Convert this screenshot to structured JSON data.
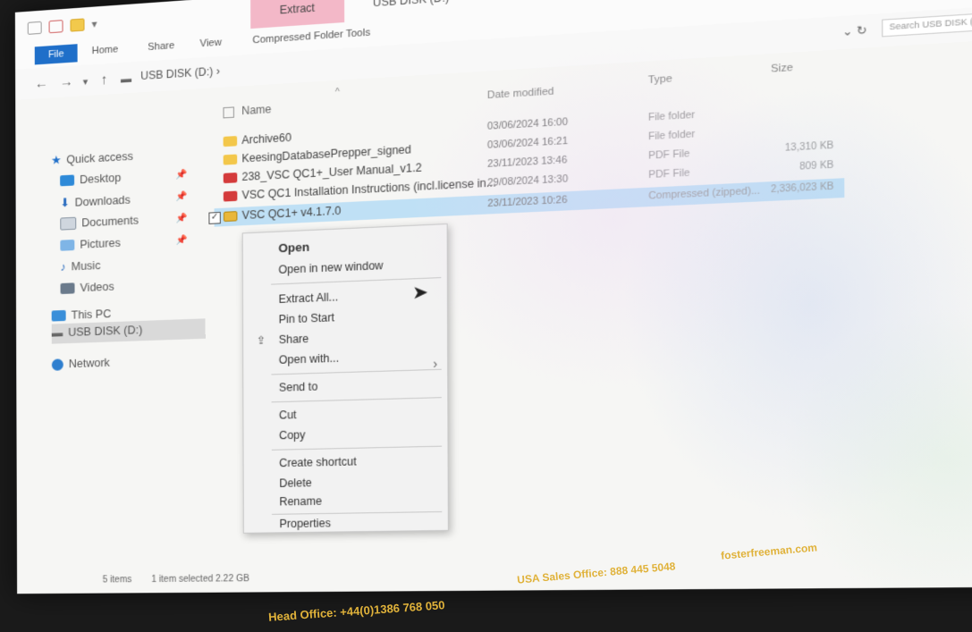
{
  "titlebar": {
    "context_tab": "Extract",
    "window_title": "USB DISK (D:)",
    "controls": [
      "—",
      "☐",
      "✕"
    ]
  },
  "ribbon": {
    "file": "File",
    "tabs": [
      "Home",
      "Share",
      "View",
      "Compressed Folder Tools"
    ]
  },
  "address": {
    "path": "USB DISK (D:)  ›",
    "search_placeholder": "Search USB DISK (D:)"
  },
  "nav": {
    "items": [
      {
        "label": "Quick access",
        "icon": "star-icon"
      },
      {
        "label": "Desktop",
        "icon": "desktop-icon"
      },
      {
        "label": "Downloads",
        "icon": "download-icon"
      },
      {
        "label": "Documents",
        "icon": "documents-icon"
      },
      {
        "label": "Pictures",
        "icon": "pictures-icon"
      },
      {
        "label": "Music",
        "icon": "music-icon"
      },
      {
        "label": "Videos",
        "icon": "videos-icon"
      },
      {
        "label": "This PC",
        "icon": "pc-icon"
      },
      {
        "label": "USB DISK (D:)",
        "icon": "usb-icon"
      },
      {
        "label": "Network",
        "icon": "network-icon"
      }
    ]
  },
  "columns": {
    "name": "Name",
    "date": "Date modified",
    "type": "Type",
    "size": "Size"
  },
  "files": [
    {
      "name": "Archive60",
      "date": "03/06/2024 16:00",
      "type": "File folder",
      "size": "",
      "icon": "folder-icon"
    },
    {
      "name": "KeesingDatabasePrepper_signed",
      "date": "03/06/2024 16:21",
      "type": "File folder",
      "size": "",
      "icon": "folder-icon"
    },
    {
      "name": "238_VSC QC1+_User Manual_v1.2",
      "date": "23/11/2023 13:46",
      "type": "PDF File",
      "size": "13,310 KB",
      "icon": "pdf-icon"
    },
    {
      "name": "VSC QC1 Installation Instructions (incl.license in...",
      "date": "29/08/2024 13:30",
      "type": "PDF File",
      "size": "809 KB",
      "icon": "pdf-icon"
    },
    {
      "name": "VSC QC1+ v4.1.7.0",
      "date": "23/11/2023 10:26",
      "type": "Compressed (zipped)...",
      "size": "2,336,023 KB",
      "icon": "zip-icon"
    }
  ],
  "context_menu": {
    "open": "Open",
    "open_new_window": "Open in new window",
    "extract_all": "Extract All...",
    "pin_to_start": "Pin to Start",
    "share": "Share",
    "open_with": "Open with...",
    "send_to": "Send to",
    "cut": "Cut",
    "copy": "Copy",
    "create_shortcut": "Create shortcut",
    "delete": "Delete",
    "rename": "Rename",
    "properties": "Properties"
  },
  "status": {
    "items": "5 items",
    "selected": "1 item selected  2.22 GB"
  },
  "bezel": {
    "head_office": "Head Office: +44(0)1386 768 050",
    "usa_office": "USA Sales Office: 888 445 5048",
    "website": "fosterfreeman.com"
  },
  "colors": {
    "accent": "#1f6fc9",
    "selection": "#bfe0f5",
    "context_tab": "#f3b8c8",
    "bezel_text": "#e0b23a"
  }
}
